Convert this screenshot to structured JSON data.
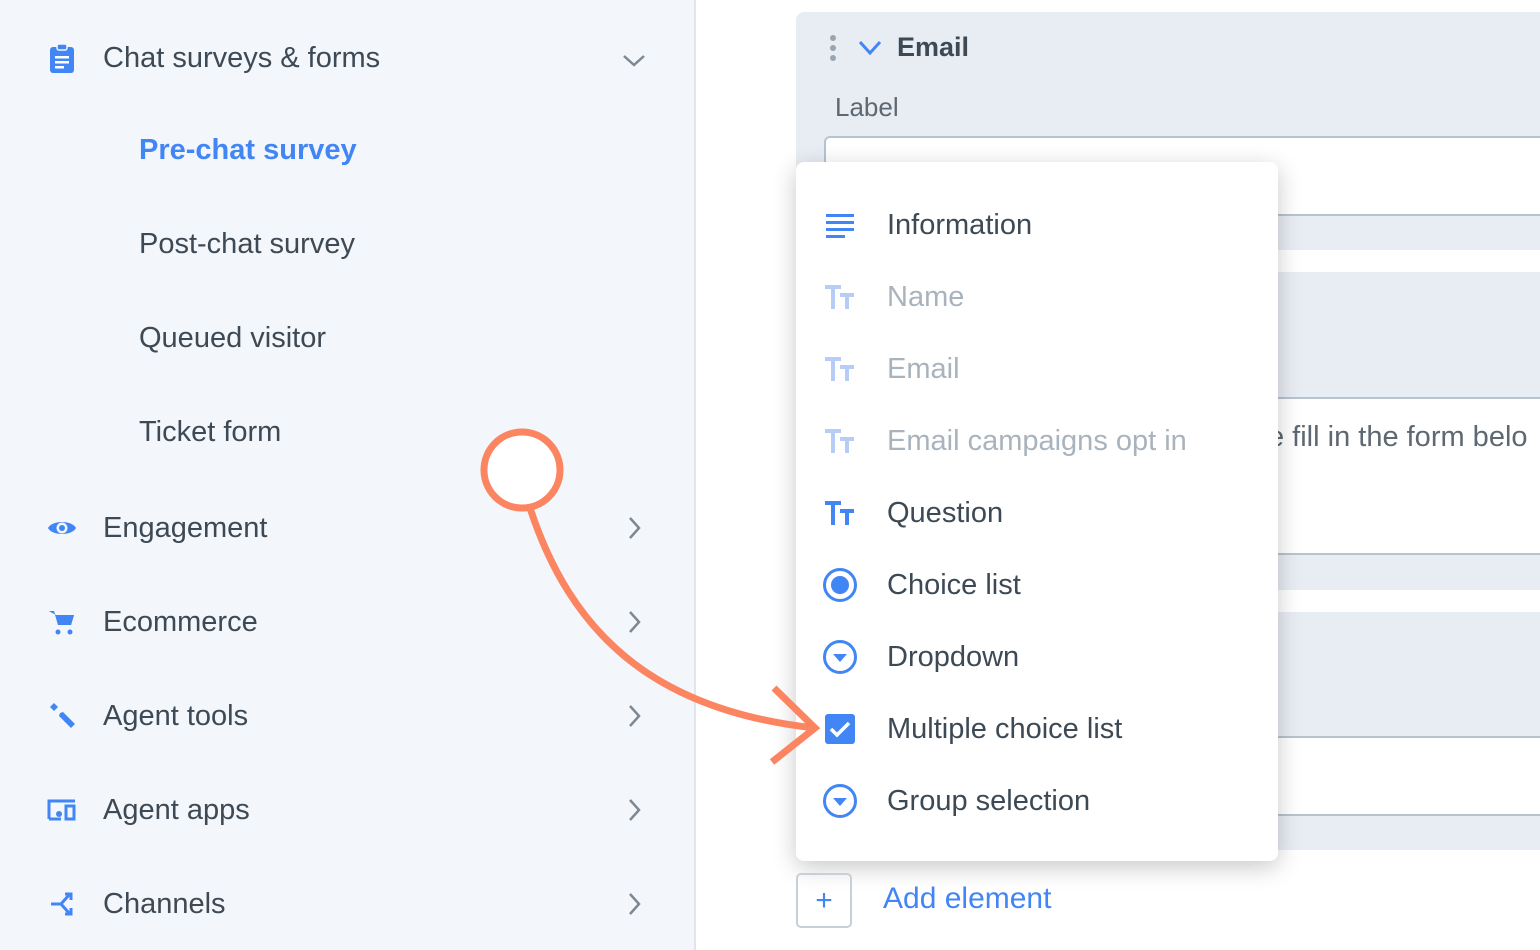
{
  "sidebar": {
    "section": {
      "label": "Chat surveys & forms",
      "icon": "clipboard-icon",
      "expanded": true
    },
    "subitems": [
      {
        "label": "Pre-chat survey",
        "active": true
      },
      {
        "label": "Post-chat survey"
      },
      {
        "label": "Queued visitor"
      },
      {
        "label": "Ticket form"
      }
    ],
    "items": [
      {
        "label": "Engagement",
        "icon": "eye-icon"
      },
      {
        "label": "Ecommerce",
        "icon": "cart-icon"
      },
      {
        "label": "Agent tools",
        "icon": "wrench-icon"
      },
      {
        "label": "Agent apps",
        "icon": "devices-icon"
      },
      {
        "label": "Channels",
        "icon": "merge-icon"
      }
    ]
  },
  "form": {
    "field_title": "Email",
    "label_caption": "Label",
    "partial_text": "e fill in the form belo"
  },
  "menu": {
    "items": [
      {
        "label": "Information",
        "icon": "lines-icon",
        "disabled": false
      },
      {
        "label": "Name",
        "icon": "text-icon",
        "disabled": true
      },
      {
        "label": "Email",
        "icon": "text-icon",
        "disabled": true
      },
      {
        "label": "Email campaigns opt in",
        "icon": "text-icon",
        "disabled": true
      },
      {
        "label": "Question",
        "icon": "text-icon",
        "disabled": false
      },
      {
        "label": "Choice list",
        "icon": "radio-icon",
        "disabled": false
      },
      {
        "label": "Dropdown",
        "icon": "dropdown-icon",
        "disabled": false
      },
      {
        "label": "Multiple choice list",
        "icon": "checkbox-icon",
        "disabled": false
      },
      {
        "label": "Group selection",
        "icon": "dropdown-icon",
        "disabled": false
      }
    ]
  },
  "add_element": {
    "plus": "+",
    "label": "Add element"
  },
  "colors": {
    "accent": "#4285f4",
    "annotation": "#fc8561",
    "sidebar_bg": "#f3f6fa"
  }
}
